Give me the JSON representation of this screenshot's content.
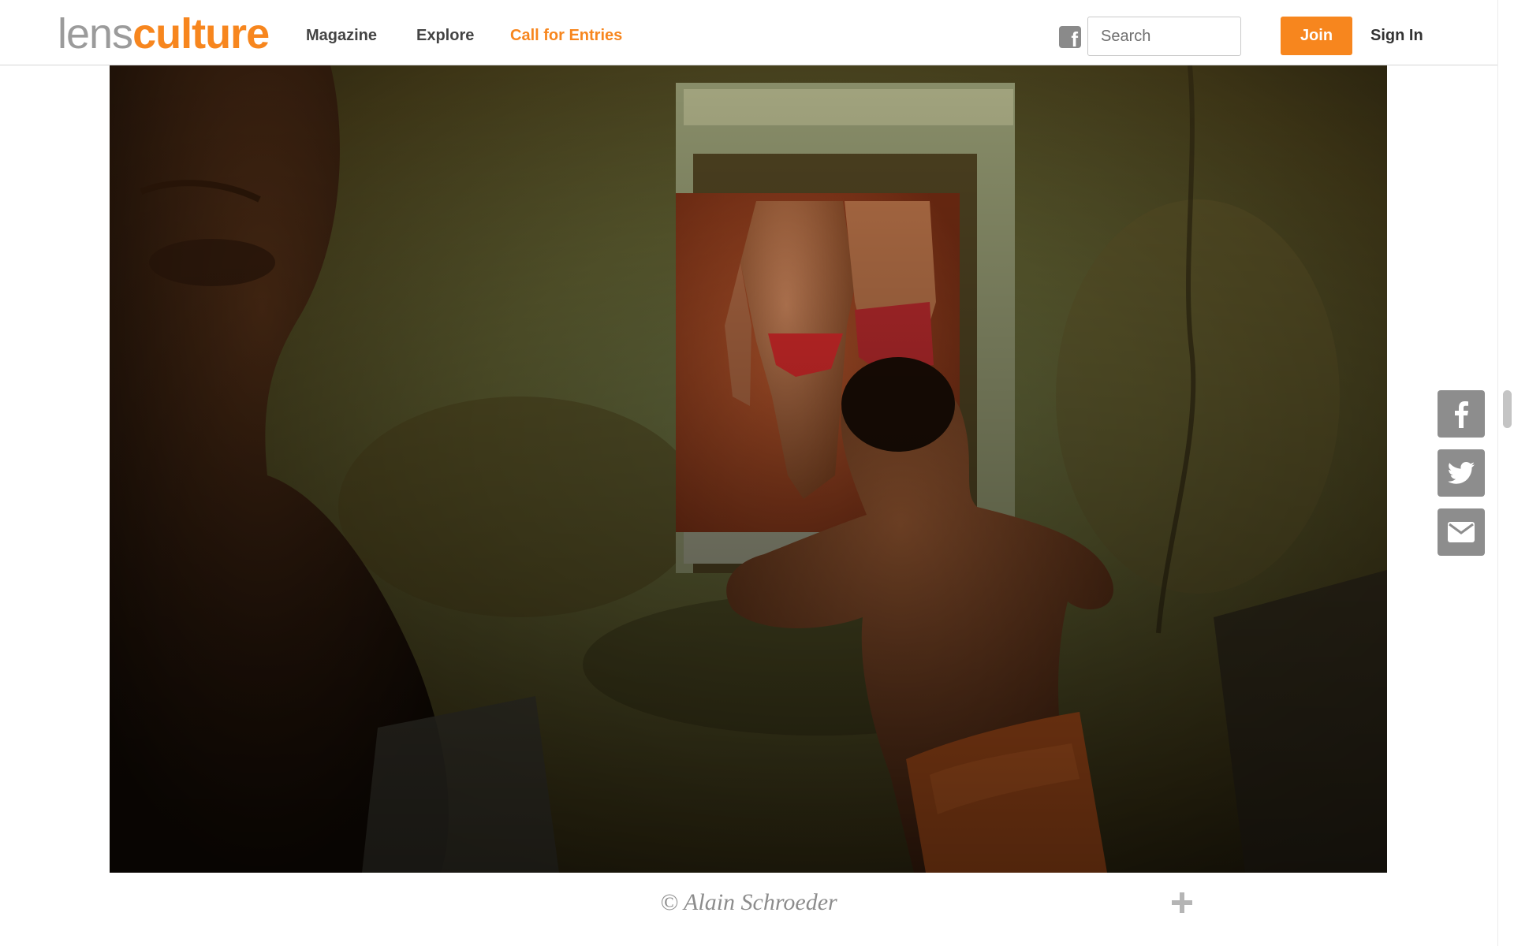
{
  "header": {
    "logo": {
      "part1": "lens",
      "part2": "culture"
    },
    "nav": [
      {
        "label": "Magazine"
      },
      {
        "label": "Explore"
      },
      {
        "label": "Call for Entries"
      }
    ],
    "social_icon": "facebook-square-icon",
    "search": {
      "placeholder": "Search",
      "value": ""
    },
    "join_label": "Join",
    "signin_label": "Sign In"
  },
  "photo": {
    "description_icon": "photograph"
  },
  "caption": {
    "credit": "© Alain Schroeder",
    "expand_icon": "plus-icon"
  },
  "share": {
    "icons": [
      "facebook-icon",
      "twitter-icon",
      "email-icon"
    ]
  },
  "colors": {
    "brand_orange": "#f7861e",
    "logo_gray": "#9b9b9b",
    "share_gray": "#8d8d8d",
    "caption_gray": "#8c8c8c"
  }
}
